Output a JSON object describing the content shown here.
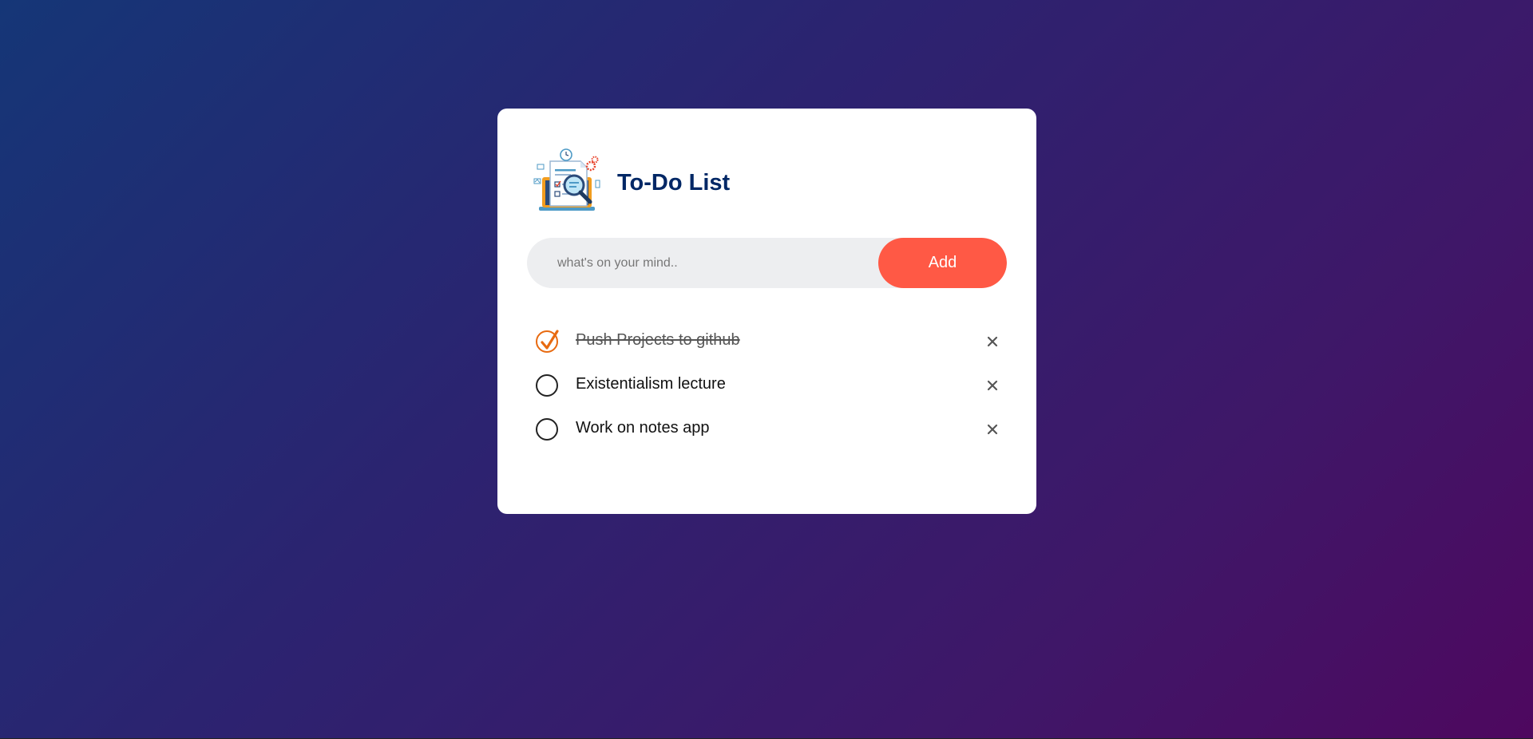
{
  "app": {
    "title": "To-Do List",
    "logo_icon": "todo-clipboard-magnifier-icon"
  },
  "input": {
    "placeholder": "what's on your mind..",
    "value": "",
    "add_label": "Add"
  },
  "colors": {
    "accent": "#ff5945",
    "title": "#002765",
    "checked": "#e86a10"
  },
  "tasks": [
    {
      "text": "Push Projects to github",
      "done": true
    },
    {
      "text": "Existentialism lecture",
      "done": false
    },
    {
      "text": "Work on notes app",
      "done": false
    }
  ]
}
